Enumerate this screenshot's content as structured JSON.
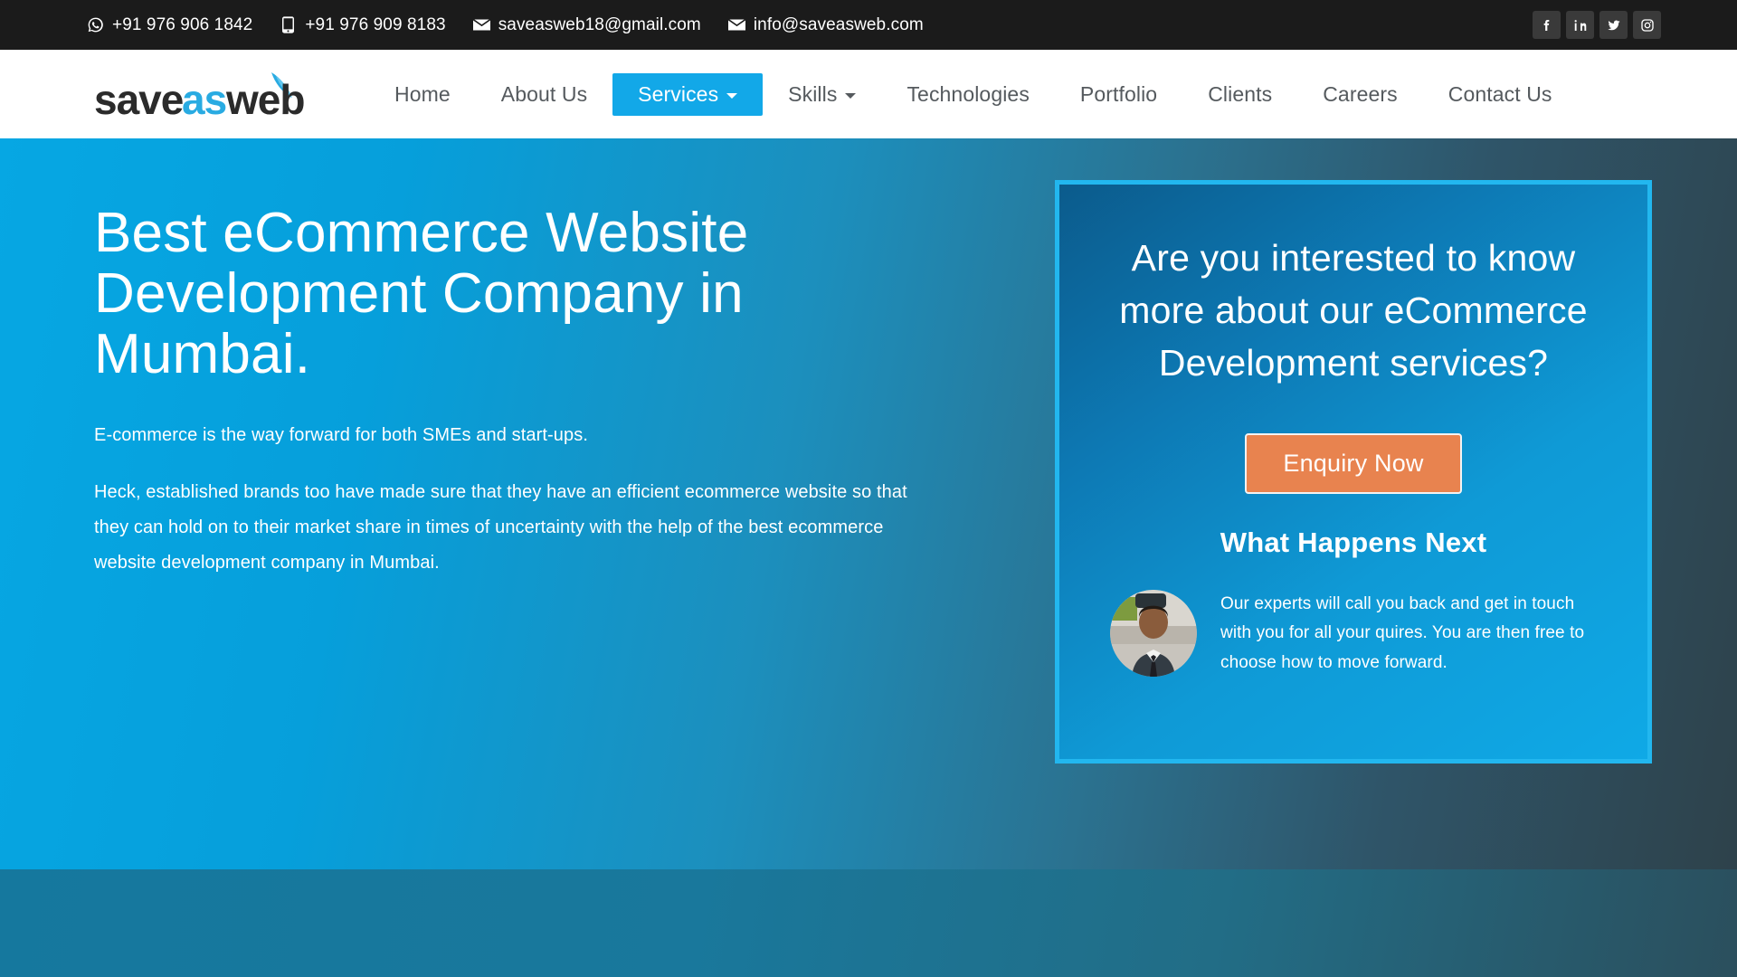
{
  "topbar": {
    "contacts": [
      {
        "icon": "whatsapp-icon",
        "text": "+91 976 906 1842"
      },
      {
        "icon": "phone-icon",
        "text": "+91 976 909 8183"
      },
      {
        "icon": "envelope-icon",
        "text": "saveasweb18@gmail.com"
      },
      {
        "icon": "envelope-icon",
        "text": "info@saveasweb.com"
      }
    ],
    "social": [
      {
        "icon": "facebook-icon",
        "name": "Facebook"
      },
      {
        "icon": "linkedin-icon",
        "name": "LinkedIn"
      },
      {
        "icon": "twitter-icon",
        "name": "Twitter"
      },
      {
        "icon": "instagram-icon",
        "name": "Instagram"
      }
    ]
  },
  "header": {
    "logo_text": "saveasweb",
    "logo_part1": "save",
    "logo_part2": "as",
    "logo_part3": "web",
    "nav": [
      {
        "label": "Home",
        "active": false,
        "dropdown": false
      },
      {
        "label": "About Us",
        "active": false,
        "dropdown": false
      },
      {
        "label": "Services",
        "active": true,
        "dropdown": true
      },
      {
        "label": "Skills",
        "active": false,
        "dropdown": true
      },
      {
        "label": "Technologies",
        "active": false,
        "dropdown": false
      },
      {
        "label": "Portfolio",
        "active": false,
        "dropdown": false
      },
      {
        "label": "Clients",
        "active": false,
        "dropdown": false
      },
      {
        "label": "Careers",
        "active": false,
        "dropdown": false
      },
      {
        "label": "Contact Us",
        "active": false,
        "dropdown": false
      }
    ]
  },
  "hero": {
    "title": "Best eCommerce Website Development Company in Mumbai.",
    "subtitle": "E-commerce is the way forward for both SMEs and start-ups.",
    "paragraph": "Heck, established brands too have made sure that they have an efficient ecommerce website so that they can hold on to their market share in times of uncertainty with the help of the best ecommerce website development company in Mumbai.",
    "card": {
      "title": "Are you interested to know more about our eCommerce Development services?",
      "button_label": "Enquiry Now",
      "what_next_heading": "What Happens Next",
      "expert_text": "Our experts will call you back and get in touch with you for all your quires. You are then free to choose how to move forward."
    }
  },
  "colors": {
    "topbar_bg": "#1b1b1b",
    "accent_blue": "#12a8e8",
    "card_border": "#22b7ef",
    "button_orange": "#e8834f",
    "hero_left": "#06a7e3",
    "hero_right": "#2e424b",
    "nav_text": "#555a5e"
  }
}
